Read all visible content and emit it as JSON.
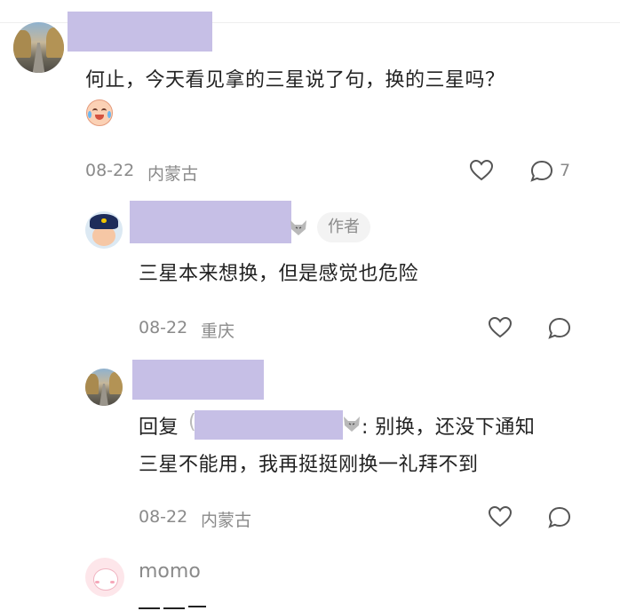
{
  "comments": [
    {
      "text": "何止，今天看见拿的三星说了句，换的三星吗？",
      "emoji": "crying-laughing-emoji",
      "date": "08-22",
      "location": "内蒙古",
      "reply_count": "7"
    },
    {
      "author_tag": "作者",
      "text": "三星本来想换，但是感觉也危险",
      "date": "08-22",
      "location": "重庆"
    },
    {
      "reply_prefix": "回复",
      "reply_text_line1": ": 别换，还没下通知",
      "reply_text_line2": "三星不能用，我再挺挺刚换一礼拜不到",
      "date": "08-22",
      "location": "内蒙古"
    },
    {
      "username": "momo"
    }
  ],
  "colors": {
    "redaction": "#c6bfe6",
    "meta_text": "#8a8a8a"
  }
}
